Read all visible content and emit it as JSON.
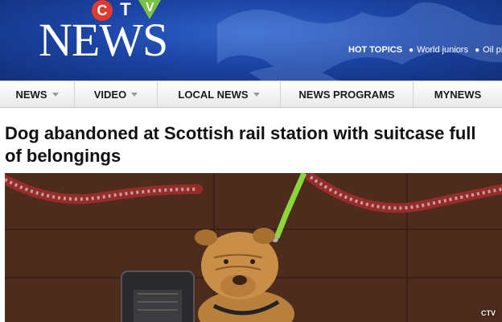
{
  "brand": {
    "ctv_letters": [
      "C",
      "T",
      "V"
    ],
    "news_word": "NEWS"
  },
  "hot_topics": {
    "label": "HOT TOPICS",
    "items": [
      "World juniors",
      "Oil pr"
    ]
  },
  "nav": {
    "items": [
      {
        "label": "NEWS",
        "has_dropdown": true
      },
      {
        "label": "VIDEO",
        "has_dropdown": true
      },
      {
        "label": "LOCAL NEWS",
        "has_dropdown": true
      },
      {
        "label": "NEWS PROGRAMS",
        "has_dropdown": false
      },
      {
        "label": "MYNEWS",
        "has_dropdown": false
      }
    ]
  },
  "article": {
    "headline": "Dog abandoned at Scottish rail station with suitcase full of belongings",
    "photo_credit": "CTV"
  },
  "colors": {
    "banner_blue": "#1c45a6",
    "ctv_red": "#e23a2e",
    "ctv_green": "#7cc242",
    "leash_green": "#8bd63a"
  },
  "icons": [
    "dropdown-caret-icon",
    "bullet-dot-icon"
  ]
}
